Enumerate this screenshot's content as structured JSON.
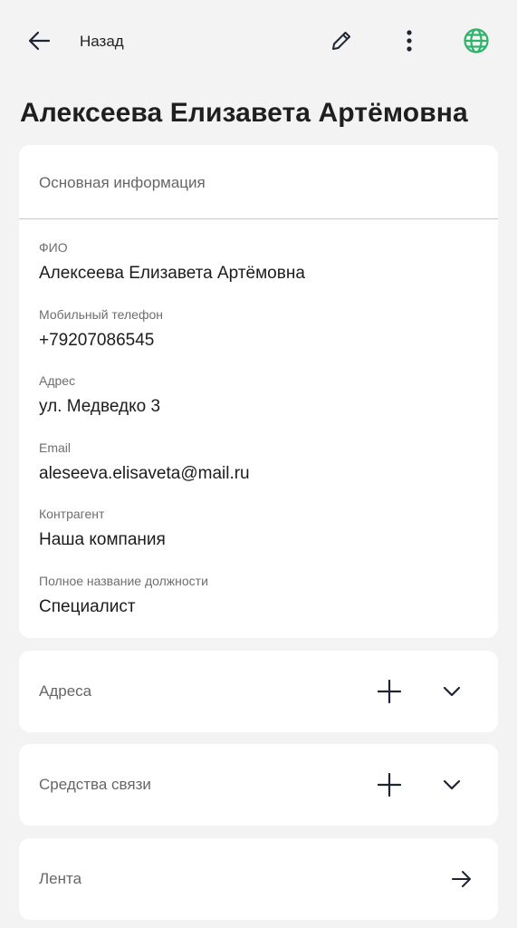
{
  "header": {
    "back_label": "Назад",
    "icons": [
      "arrow-left-icon",
      "pencil-icon",
      "more-vertical-icon",
      "globe-icon"
    ],
    "globe_color": "#2fb36a"
  },
  "title": "Алексеева Елизавета Артёмовна",
  "info": {
    "section_title": "Основная информация",
    "fields": [
      {
        "label": "ФИО",
        "value": "Алексеева Елизавета Артёмовна"
      },
      {
        "label": "Мобильный телефон",
        "value": "+79207086545"
      },
      {
        "label": "Адрес",
        "value": "ул. Медведко 3"
      },
      {
        "label": "Email",
        "value": "aleseeva.elisaveta@mail.ru"
      },
      {
        "label": "Контрагент",
        "value": "Наша компания"
      },
      {
        "label": "Полное название должности",
        "value": "Специалист"
      }
    ]
  },
  "sections": {
    "addresses": {
      "title": "Адреса"
    },
    "contacts": {
      "title": "Средства связи"
    },
    "feed": {
      "title": "Лента"
    }
  }
}
